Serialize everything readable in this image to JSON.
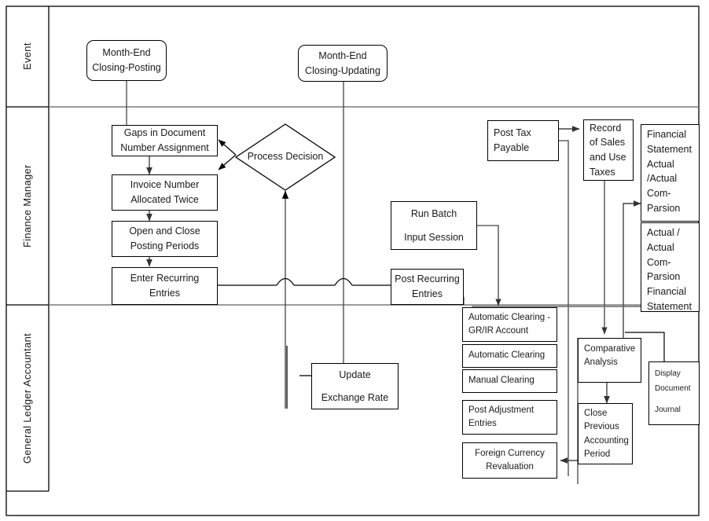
{
  "diagram": {
    "title": "Month-End Closing Process Swimlane Flowchart",
    "line_color": "#000000",
    "connector_color": "#555555",
    "background": "#ffffff"
  },
  "lanes": [
    {
      "id": "event",
      "label": "Event"
    },
    {
      "id": "finance-manager",
      "label": "Finance Manager"
    },
    {
      "id": "gl-accountant",
      "label_line1": "General Ledger",
      "label_line2": "Accountant"
    }
  ],
  "nodes": {
    "month_end_posting": {
      "line1": "Month-End",
      "line2": "Closing-Posting",
      "shape": "rounded-rect",
      "lane": "event"
    },
    "month_end_updating": {
      "line1": "Month-End",
      "line2": "Closing-Updating",
      "shape": "rounded-rect",
      "lane": "event"
    },
    "gaps_in_document": {
      "line1": "Gaps in Document",
      "line2": "Number Assignment",
      "shape": "rect",
      "lane": "finance-manager"
    },
    "invoice_number": {
      "line1": "Invoice Number",
      "line2": "Allocated Twice",
      "shape": "rect",
      "lane": "finance-manager"
    },
    "open_close_periods": {
      "line1": "Open and Close",
      "line2": "Posting Periods",
      "shape": "rect",
      "lane": "finance-manager"
    },
    "enter_recurring": {
      "line1": "Enter Recurring",
      "line2": "Entries",
      "shape": "rect",
      "lane": "finance-manager"
    },
    "process_decision": {
      "line1": "Process",
      "line2": "Decision",
      "shape": "diamond",
      "lane": "finance-manager"
    },
    "run_batch": {
      "line1": "Run Batch",
      "line2": "Input Session",
      "shape": "rect",
      "lane": "finance-manager"
    },
    "post_recurring": {
      "line1": "Post Recurring",
      "line2": "Entries",
      "shape": "rect",
      "lane": "finance-manager"
    },
    "post_tax_payable": {
      "line1": "Post Tax",
      "line2": "Payable",
      "shape": "rect",
      "lane": "finance-manager"
    },
    "record_of_sales": {
      "line1": "Record",
      "line2": "of Sales",
      "line3": "and Use",
      "line4": "Taxes",
      "shape": "rect",
      "lane": "finance-manager"
    },
    "financial_statement_actual": {
      "line1": "Financial",
      "line2": "Statement",
      "line3": "Actual",
      "line4": "/Actual",
      "line5": "Com-",
      "line6": "Parsion",
      "shape": "rect",
      "lane": "finance-manager"
    },
    "actual_actual_comparsion": {
      "line1": "Actual /",
      "line2": "Actual",
      "line3": "Com-",
      "line4": "Parsion",
      "line5": "Financial",
      "line6": "Statement",
      "shape": "rect",
      "lane": "finance-manager"
    },
    "update_exchange_rate": {
      "line1": "Update",
      "line2": "Exchange Rate",
      "shape": "rect",
      "lane": "gl-accountant"
    },
    "auto_clearing_grir": {
      "line1": "Automatic Clearing -",
      "line2": "GR/IR Account",
      "shape": "rect",
      "lane": "gl-accountant"
    },
    "automatic_clearing": {
      "line1": "Automatic Clearing",
      "shape": "rect",
      "lane": "gl-accountant"
    },
    "manual_clearing": {
      "line1": "Manual Clearing",
      "shape": "rect",
      "lane": "gl-accountant"
    },
    "post_adjustment": {
      "line1": "Post  Adjustment",
      "line2": "Entries",
      "shape": "rect",
      "lane": "gl-accountant"
    },
    "foreign_currency": {
      "line1": "Foreign Currency",
      "line2": "Revaluation",
      "shape": "rect",
      "lane": "gl-accountant"
    },
    "comparative_analysis": {
      "line1": "Comparative",
      "line2": "Analysis",
      "shape": "rect",
      "lane": "gl-accountant"
    },
    "close_previous_period": {
      "line1": "Close",
      "line2": "Previous",
      "line3": "Accounting",
      "line4": "Period",
      "shape": "rect",
      "lane": "gl-accountant"
    },
    "display_document_journal": {
      "line1": "Display",
      "line2": "Document",
      "line3": "Journal",
      "shape": "rect",
      "lane": "gl-accountant"
    }
  },
  "connections": [
    {
      "from": "month_end_posting",
      "to": "gaps_in_document"
    },
    {
      "from": "gaps_in_document",
      "to": "invoice_number"
    },
    {
      "from": "invoice_number",
      "to": "open_close_periods"
    },
    {
      "from": "open_close_periods",
      "to": "enter_recurring"
    },
    {
      "from": "gaps_in_document",
      "to": "process_decision",
      "type": "bidirectional"
    },
    {
      "from": "enter_recurring",
      "to": "post_recurring"
    },
    {
      "from": "enter_recurring",
      "to": "process_decision"
    },
    {
      "from": "month_end_updating",
      "to": "update_exchange_rate"
    },
    {
      "from": "run_batch",
      "to": "auto_clearing_grir"
    },
    {
      "from": "post_tax_payable",
      "to": "record_of_sales"
    },
    {
      "from": "post_tax_payable",
      "to": "comparative_analysis"
    },
    {
      "from": "record_of_sales",
      "to": "comparative_analysis"
    },
    {
      "from": "actual_actual_comparsion",
      "to": "financial_statement_actual"
    },
    {
      "from": "comparative_analysis",
      "to": "close_previous_period"
    },
    {
      "from": "close_previous_period",
      "to": "foreign_currency"
    },
    {
      "from": "comparative_analysis",
      "to": "display_document_journal"
    }
  ]
}
